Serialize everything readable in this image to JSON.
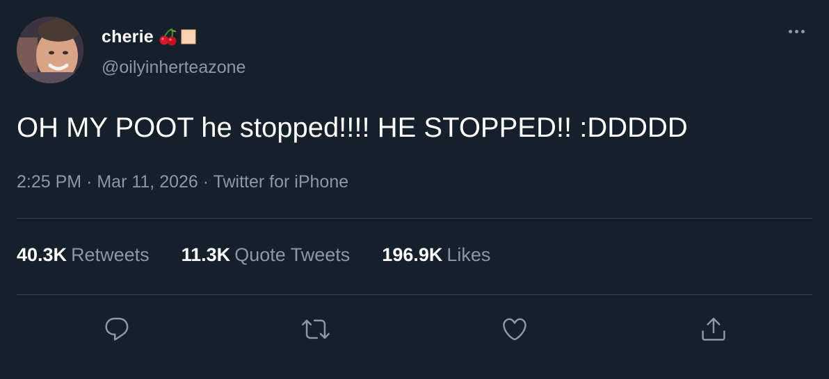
{
  "tweet": {
    "display_name": "cherie",
    "handle": "@oilyinherteazone",
    "text": "OH MY POOT he stopped!!!! HE STOPPED!! :DDDDD",
    "time": "2:25 PM",
    "date": "Mar 11, 2026",
    "source": "Twitter for iPhone",
    "name_emojis": [
      "cherries-emoji",
      "skin-tone-square-emoji"
    ]
  },
  "stats": {
    "retweets_count": "40.3K",
    "retweets_label": "Retweets",
    "quotes_count": "11.3K",
    "quotes_label": "Quote Tweets",
    "likes_count": "196.9K",
    "likes_label": "Likes"
  },
  "actions": {
    "reply_icon": "reply-icon",
    "retweet_icon": "retweet-icon",
    "like_icon": "heart-icon",
    "share_icon": "share-icon"
  },
  "colors": {
    "background": "#15202b",
    "text_primary": "#ffffff",
    "text_secondary": "#8b98a5",
    "divider": "#38444d"
  }
}
